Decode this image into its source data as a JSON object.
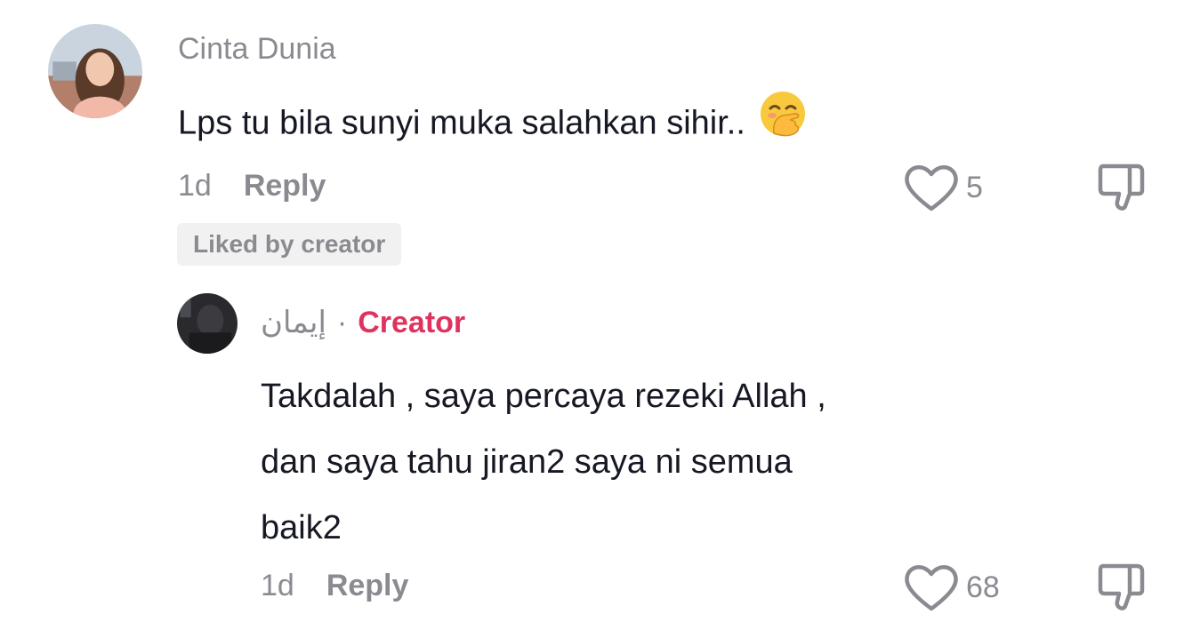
{
  "comments": [
    {
      "username": "Cinta Dunia",
      "text": "Lps tu bila sunyi muka salahkan sihir..",
      "emoji": "hand-over-mouth-emoji",
      "time": "1d",
      "reply_label": "Reply",
      "likes": "5",
      "liked_by_creator": "Liked by creator"
    }
  ],
  "reply": {
    "username": "إيمان",
    "separator": "·",
    "creator_label": "Creator",
    "text_lines": [
      "Takdalah , saya percaya rezeki Allah ,",
      "dan saya tahu jiran2 saya ni semua",
      "baik2"
    ],
    "time": "1d",
    "reply_label": "Reply",
    "likes": "68"
  },
  "icons": {
    "like": "heart-outline-icon",
    "dislike": "thumbs-down-icon"
  },
  "colors": {
    "creator_accent": "#e0325f",
    "muted_text": "#8a8b91",
    "badge_bg": "#f1f1f2"
  }
}
